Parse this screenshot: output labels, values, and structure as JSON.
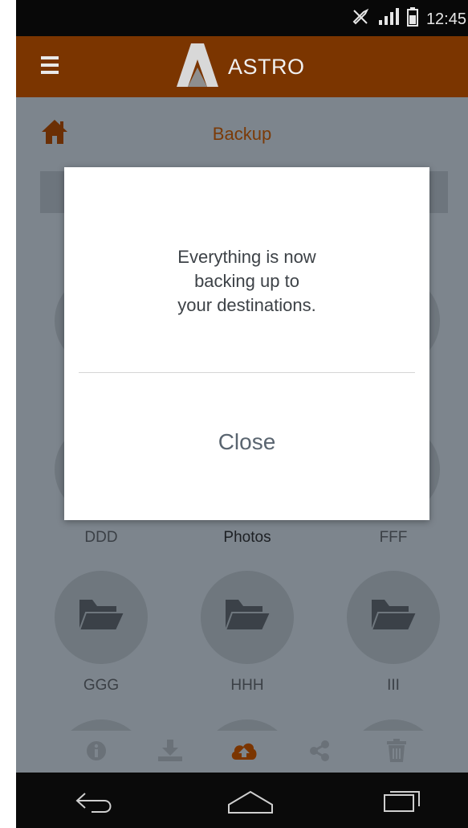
{
  "status_bar": {
    "time": "12:45",
    "icons": [
      "mute-icon",
      "signal-icon",
      "battery-icon"
    ]
  },
  "app_bar": {
    "menu_icon": "hamburger-icon",
    "brand_name": "ASTRO",
    "colors": {
      "bar": "#7b3500",
      "text": "#f0f0f0"
    }
  },
  "breadcrumb": {
    "home_icon": "home-icon",
    "title": "Backup"
  },
  "folders": [
    {
      "label": "DDD",
      "emphasis": false
    },
    {
      "label": "Photos",
      "emphasis": true
    },
    {
      "label": "FFF",
      "emphasis": false
    },
    {
      "label": "GGG",
      "emphasis": false
    },
    {
      "label": "HHH",
      "emphasis": false
    },
    {
      "label": "III",
      "emphasis": false
    }
  ],
  "toolbar": {
    "items": [
      "info-icon",
      "download-icon",
      "cloud-upload-icon",
      "share-icon",
      "trash-icon"
    ],
    "active": "cloud-upload-icon",
    "colors": {
      "active": "#7b3500",
      "inactive": "#6a7178"
    }
  },
  "dialog": {
    "message_line1": "Everything is now",
    "message_line2": "backing up to",
    "message_line3": "your destinations.",
    "close_label": "Close"
  },
  "nav_bar": {
    "items": [
      "back-icon",
      "home-nav-icon",
      "recents-icon"
    ]
  }
}
